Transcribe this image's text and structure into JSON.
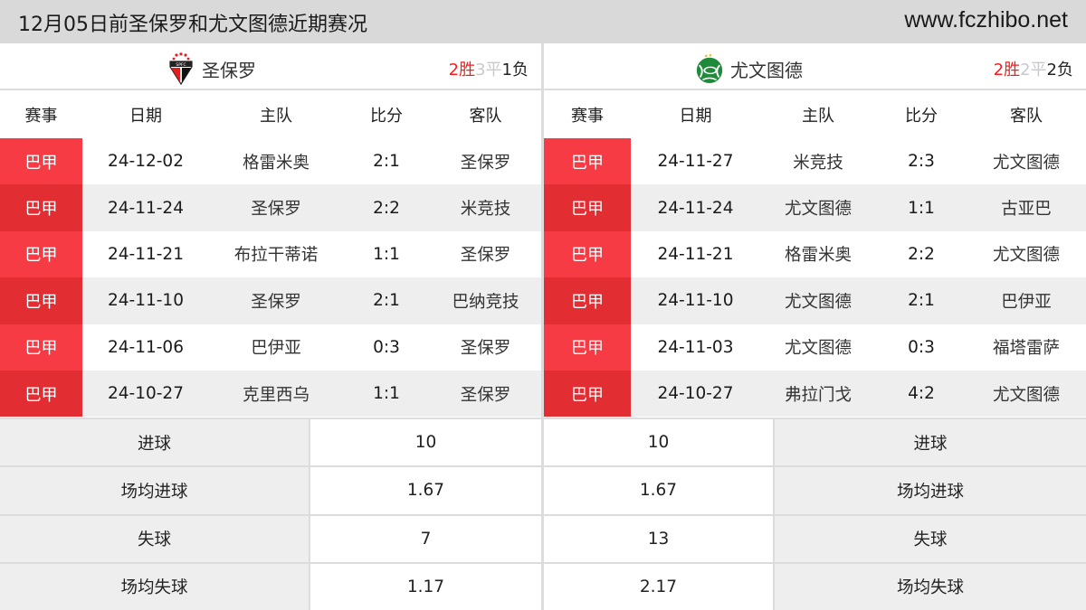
{
  "header": {
    "title": "12月05日前圣保罗和尤文图德近期赛况",
    "site": "www.fczhibo.net"
  },
  "colors": {
    "badge_odd": "#f63b44",
    "badge_even": "#e22d33",
    "win": "#ff1a1a",
    "draw": "#c8c8d0",
    "loss": "#222222"
  },
  "columns": [
    "赛事",
    "日期",
    "主队",
    "比分",
    "客队"
  ],
  "left": {
    "team": "圣保罗",
    "logo_icon": "sao-paulo-crest-icon",
    "record": {
      "win": "2胜",
      "draw": "3平",
      "loss": "1负"
    },
    "matches": [
      {
        "league": "巴甲",
        "date": "24-12-02",
        "home": "格雷米奥",
        "score": "2:1",
        "away": "圣保罗"
      },
      {
        "league": "巴甲",
        "date": "24-11-24",
        "home": "圣保罗",
        "score": "2:2",
        "away": "米竞技"
      },
      {
        "league": "巴甲",
        "date": "24-11-21",
        "home": "布拉干蒂诺",
        "score": "1:1",
        "away": "圣保罗"
      },
      {
        "league": "巴甲",
        "date": "24-11-10",
        "home": "圣保罗",
        "score": "2:1",
        "away": "巴纳竞技"
      },
      {
        "league": "巴甲",
        "date": "24-11-06",
        "home": "巴伊亚",
        "score": "0:3",
        "away": "圣保罗"
      },
      {
        "league": "巴甲",
        "date": "24-10-27",
        "home": "克里西乌",
        "score": "1:1",
        "away": "圣保罗"
      }
    ],
    "stats": [
      {
        "label": "进球",
        "value": "10"
      },
      {
        "label": "场均进球",
        "value": "1.67"
      },
      {
        "label": "失球",
        "value": "7"
      },
      {
        "label": "场均失球",
        "value": "1.17"
      }
    ]
  },
  "right": {
    "team": "尤文图德",
    "logo_icon": "juventude-crest-icon",
    "record": {
      "win": "2胜",
      "draw": "2平",
      "loss": "2负"
    },
    "matches": [
      {
        "league": "巴甲",
        "date": "24-11-27",
        "home": "米竞技",
        "score": "2:3",
        "away": "尤文图德"
      },
      {
        "league": "巴甲",
        "date": "24-11-24",
        "home": "尤文图德",
        "score": "1:1",
        "away": "古亚巴"
      },
      {
        "league": "巴甲",
        "date": "24-11-21",
        "home": "格雷米奥",
        "score": "2:2",
        "away": "尤文图德"
      },
      {
        "league": "巴甲",
        "date": "24-11-10",
        "home": "尤文图德",
        "score": "2:1",
        "away": "巴伊亚"
      },
      {
        "league": "巴甲",
        "date": "24-11-03",
        "home": "尤文图德",
        "score": "0:3",
        "away": "福塔雷萨"
      },
      {
        "league": "巴甲",
        "date": "24-10-27",
        "home": "弗拉门戈",
        "score": "4:2",
        "away": "尤文图德"
      }
    ],
    "stats": [
      {
        "label": "进球",
        "value": "10"
      },
      {
        "label": "场均进球",
        "value": "1.67"
      },
      {
        "label": "失球",
        "value": "13"
      },
      {
        "label": "场均失球",
        "value": "2.17"
      }
    ]
  }
}
